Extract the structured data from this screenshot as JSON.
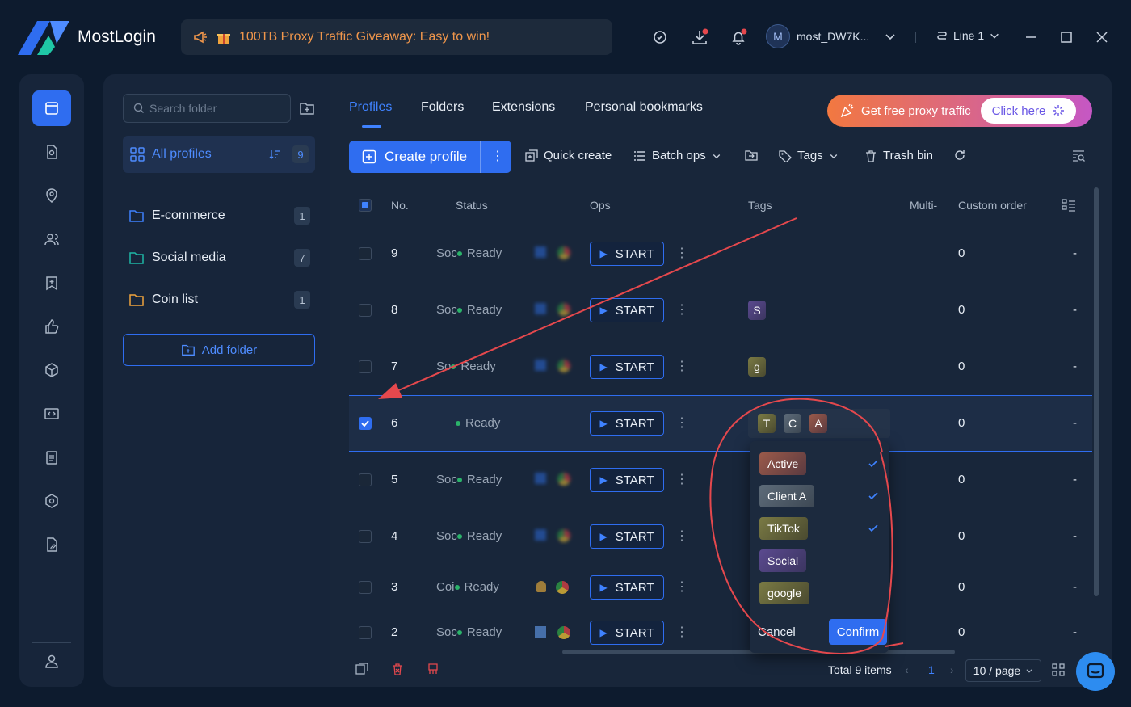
{
  "app": {
    "name": "MostLogin"
  },
  "promo": {
    "text": "100TB Proxy Traffic Giveaway: Easy to win!"
  },
  "header": {
    "icons": [
      "support-icon",
      "download-icon",
      "bell-icon"
    ],
    "user": {
      "avatar_letter": "M",
      "name": "most_DW7K..."
    },
    "line": "Line 1"
  },
  "rail": {
    "items": [
      "browser-profiles",
      "profile-audit",
      "proxy",
      "team",
      "bookmark",
      "like",
      "package",
      "api",
      "clipboard",
      "settings",
      "document",
      "account"
    ]
  },
  "folders": {
    "search_placeholder": "Search folder",
    "all_profiles": {
      "label": "All profiles",
      "count": "9"
    },
    "items": [
      {
        "label": "E-commerce",
        "count": "1",
        "color": "#3f82ff"
      },
      {
        "label": "Social media",
        "count": "7",
        "color": "#1fb8a6"
      },
      {
        "label": "Coin list",
        "count": "1",
        "color": "#f0a33c"
      }
    ],
    "add_label": "Add folder"
  },
  "tabs": [
    "Profiles",
    "Folders",
    "Extensions",
    "Personal bookmarks"
  ],
  "proxy_banner": {
    "text": "Get free proxy traffic",
    "button": "Click here"
  },
  "toolbar": {
    "create": "Create profile",
    "quick_create": "Quick create",
    "batch_ops": "Batch ops",
    "tags": "Tags",
    "trash": "Trash bin"
  },
  "table": {
    "headers": {
      "no": "No.",
      "status": "Status",
      "ops": "Ops",
      "tags": "Tags",
      "multi": "Multi-",
      "custom_order": "Custom order"
    },
    "rows": [
      {
        "no": "9",
        "group": "Soc",
        "status": "Ready",
        "tags": [],
        "order": "0",
        "extra": "-"
      },
      {
        "no": "8",
        "group": "Soc",
        "status": "Ready",
        "tags": [
          "S"
        ],
        "order": "0",
        "extra": "-"
      },
      {
        "no": "7",
        "group": "So",
        "status": "Ready",
        "tags": [
          "g"
        ],
        "order": "0",
        "extra": "-"
      },
      {
        "no": "6",
        "group": "",
        "status": "Ready",
        "tags": [
          "T",
          "C",
          "A"
        ],
        "order": "0",
        "extra": "-"
      },
      {
        "no": "5",
        "group": "Soc",
        "status": "Ready",
        "tags": [],
        "order": "0",
        "extra": "-"
      },
      {
        "no": "4",
        "group": "Soc",
        "status": "Ready",
        "tags": [],
        "order": "0",
        "extra": "-"
      },
      {
        "no": "3",
        "group": "Coi",
        "status": "Ready",
        "tags": [],
        "order": "0",
        "extra": "-"
      },
      {
        "no": "2",
        "group": "Soc",
        "status": "Ready",
        "tags": [],
        "order": "0",
        "extra": "-"
      }
    ],
    "start_label": "START"
  },
  "tag_dropdown": {
    "items": [
      {
        "label": "Active",
        "checked": true
      },
      {
        "label": "Client A",
        "checked": true
      },
      {
        "label": "TikTok",
        "checked": true
      },
      {
        "label": "Social",
        "checked": false
      },
      {
        "label": "google",
        "checked": false
      }
    ],
    "cancel": "Cancel",
    "confirm": "Confirm"
  },
  "footer": {
    "total": "Total 9 items",
    "page": "1",
    "page_size": "10 / page"
  }
}
